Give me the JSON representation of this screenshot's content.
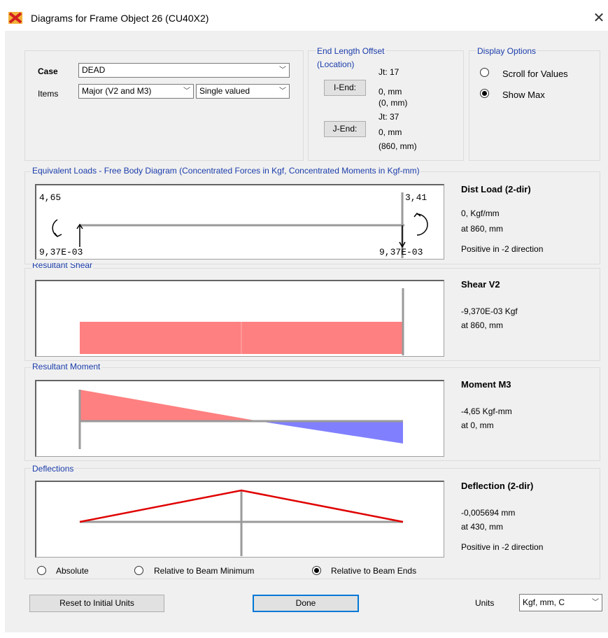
{
  "window": {
    "title": "Diagrams for Frame Object 26  (CU40X2)"
  },
  "case": {
    "label": "Case",
    "value": "DEAD"
  },
  "items": {
    "label": "Items",
    "component": "Major (V2 and M3)",
    "mode": "Single valued"
  },
  "end_offset": {
    "legend_line1": "End Length Offset",
    "legend_line2": "(Location)",
    "i_end": {
      "button": "I-End:",
      "jt": "Jt:  17",
      "offset": "0, mm",
      "location": "(0, mm)"
    },
    "j_end": {
      "button": "J-End:",
      "jt": "Jt:  37",
      "offset": "0, mm",
      "location": "(860, mm)"
    }
  },
  "display_options": {
    "legend": "Display Options",
    "scroll": "Scroll for Values",
    "show_max": "Show Max",
    "selected": "Show Max"
  },
  "fbd": {
    "legend": "Equivalent Loads - Free Body Diagram  (Concentrated Forces in Kgf, Concentrated Moments in Kgf-mm)",
    "moment_left": "4,65",
    "moment_right": "3,41",
    "force_left": "9,37E-03",
    "force_right": "9,37E-03",
    "info_title": "Dist Load (2-dir)",
    "info_value": "0, Kgf/mm",
    "info_location": "at 860, mm",
    "info_note": "Positive in -2 direction"
  },
  "shear": {
    "legend": "Resultant Shear",
    "info_title": "Shear V2",
    "info_value": "-9,370E-03 Kgf",
    "info_location": "at 860, mm",
    "fill_color": "#ff8080"
  },
  "moment": {
    "legend": "Resultant Moment",
    "info_title": "Moment M3",
    "info_value": "-4,65 Kgf-mm",
    "info_location": "at 0, mm",
    "positive_color": "#ff8080",
    "negative_color": "#8080ff"
  },
  "deflection": {
    "legend": "Deflections",
    "info_title": "Deflection (2-dir)",
    "info_value": "-0,005694 mm",
    "info_location": "at 430, mm",
    "info_note": "Positive in -2 direction",
    "line_color": "#e00000",
    "options": {
      "absolute": "Absolute",
      "relative_min": "Relative to Beam Minimum",
      "relative_ends": "Relative to Beam Ends",
      "selected": "Relative to Beam Ends"
    }
  },
  "footer": {
    "reset": "Reset to Initial Units",
    "done": "Done",
    "units_label": "Units",
    "units_value": "Kgf, mm, C"
  }
}
